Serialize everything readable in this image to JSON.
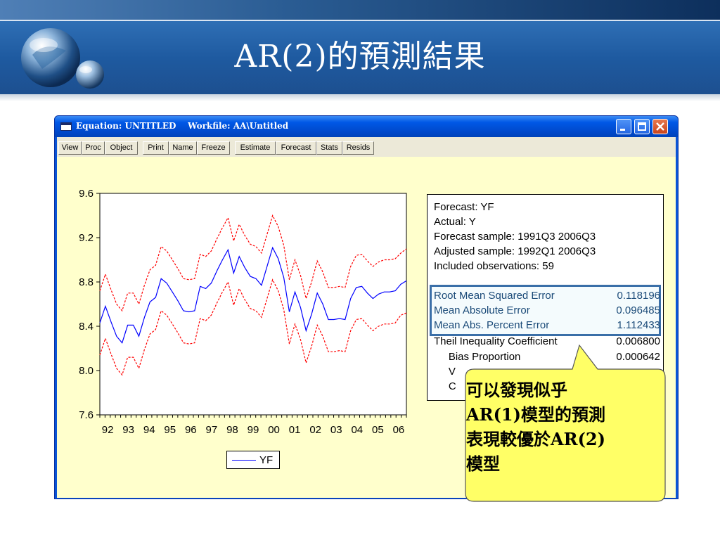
{
  "slide": {
    "title": "AR(2)的預測結果"
  },
  "window": {
    "title": "Equation: UNTITLED    Workfile: AA\\Untitled",
    "controls": [
      "minimize",
      "maximize",
      "close"
    ]
  },
  "toolbar": {
    "buttons": [
      "View",
      "Proc",
      "Object",
      "Print",
      "Name",
      "Freeze",
      "Estimate",
      "Forecast",
      "Stats",
      "Resids"
    ]
  },
  "chart_data": {
    "type": "line",
    "ylim": [
      7.6,
      9.6
    ],
    "y_ticks": [
      "9.6",
      "9.2",
      "8.8",
      "8.4",
      "8.0",
      "7.6"
    ],
    "x_ticks": [
      "92",
      "93",
      "94",
      "95",
      "96",
      "97",
      "98",
      "99",
      "00",
      "01",
      "02",
      "03",
      "04",
      "05",
      "06"
    ],
    "x_start": "1992Q1",
    "x_end": "2006Q3",
    "legend": "YF",
    "series": [
      {
        "name": "YF",
        "color": "#0000ff",
        "style": "solid",
        "values": [
          8.43,
          8.58,
          8.44,
          8.31,
          8.25,
          8.41,
          8.41,
          8.31,
          8.48,
          8.62,
          8.66,
          8.83,
          8.79,
          8.71,
          8.63,
          8.54,
          8.53,
          8.54,
          8.76,
          8.74,
          8.79,
          8.9,
          9.0,
          9.09,
          8.88,
          9.03,
          8.93,
          8.85,
          8.83,
          8.77,
          8.94,
          9.11,
          9.01,
          8.84,
          8.53,
          8.71,
          8.57,
          8.36,
          8.51,
          8.7,
          8.6,
          8.46,
          8.46,
          8.47,
          8.46,
          8.65,
          8.75,
          8.76,
          8.7,
          8.65,
          8.69,
          8.71,
          8.71,
          8.72,
          8.78,
          8.81
        ]
      },
      {
        "name": "upper",
        "color": "#ff0000",
        "style": "dashed",
        "values": [
          8.72,
          8.87,
          8.73,
          8.6,
          8.54,
          8.7,
          8.7,
          8.6,
          8.77,
          8.91,
          8.95,
          9.12,
          9.08,
          9.0,
          8.92,
          8.83,
          8.82,
          8.83,
          9.05,
          9.03,
          9.08,
          9.19,
          9.29,
          9.38,
          9.17,
          9.32,
          9.22,
          9.14,
          9.12,
          9.06,
          9.23,
          9.4,
          9.3,
          9.13,
          8.82,
          9.0,
          8.86,
          8.65,
          8.8,
          8.99,
          8.89,
          8.75,
          8.75,
          8.76,
          8.75,
          8.94,
          9.04,
          9.05,
          8.99,
          8.94,
          8.98,
          9.0,
          9.0,
          9.01,
          9.06,
          9.1
        ]
      },
      {
        "name": "lower",
        "color": "#ff0000",
        "style": "dashed",
        "values": [
          8.14,
          8.29,
          8.15,
          8.02,
          7.96,
          8.12,
          8.12,
          8.02,
          8.19,
          8.33,
          8.37,
          8.54,
          8.5,
          8.42,
          8.34,
          8.25,
          8.24,
          8.25,
          8.47,
          8.45,
          8.5,
          8.61,
          8.71,
          8.8,
          8.59,
          8.74,
          8.64,
          8.56,
          8.54,
          8.48,
          8.65,
          8.82,
          8.72,
          8.55,
          8.24,
          8.42,
          8.28,
          8.07,
          8.22,
          8.41,
          8.31,
          8.17,
          8.17,
          8.18,
          8.17,
          8.36,
          8.46,
          8.47,
          8.41,
          8.36,
          8.4,
          8.42,
          8.42,
          8.43,
          8.5,
          8.52
        ]
      }
    ]
  },
  "stats": {
    "header_lines": [
      "Forecast: YF",
      "Actual: Y",
      "Forecast sample: 1991Q3 2006Q3",
      "Adjusted sample: 1992Q1 2006Q3",
      "Included observations: 59"
    ],
    "rows": [
      {
        "label": "Root Mean Squared Error",
        "value": "0.118196"
      },
      {
        "label": "Mean Absolute Error",
        "value": "0.096485"
      },
      {
        "label": "Mean Abs. Percent Error",
        "value": "1.112433"
      },
      {
        "label": "Theil Inequality Coefficient",
        "value": "0.006800"
      },
      {
        "label": "     Bias Proportion",
        "value": "0.000642"
      },
      {
        "label": "     V",
        "value": ""
      },
      {
        "label": "     C",
        "value": ""
      }
    ]
  },
  "callout": {
    "line1": "可以發現似乎",
    "line2": "AR(1)模型的預測",
    "line3": "表現較優於AR(2)",
    "line4": "模型"
  }
}
